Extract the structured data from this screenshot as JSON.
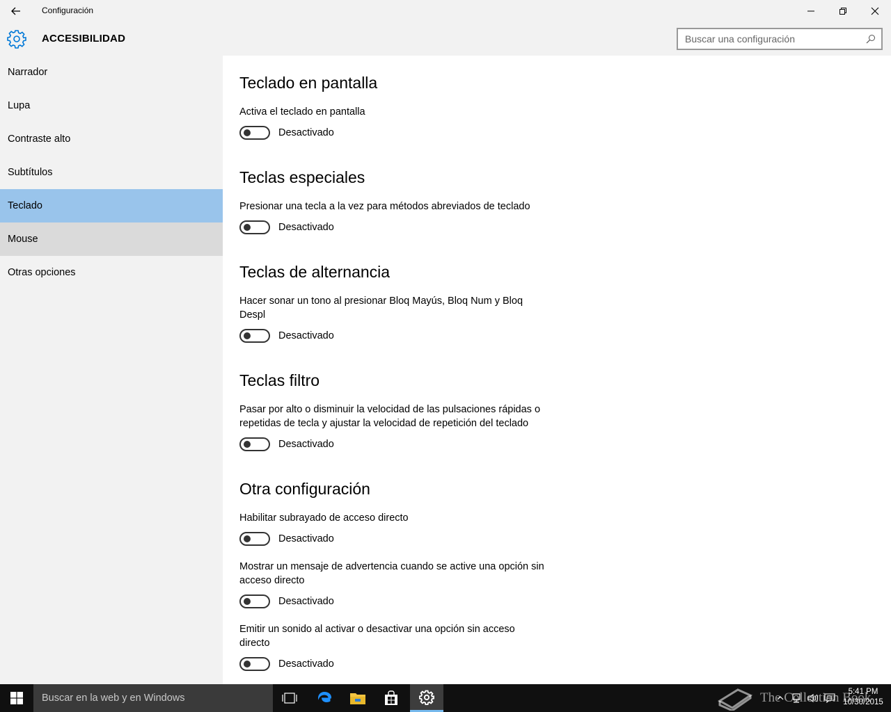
{
  "window": {
    "title": "Configuración"
  },
  "header": {
    "section_title": "ACCESIBILIDAD",
    "search_placeholder": "Buscar una configuración"
  },
  "sidebar": {
    "items": [
      {
        "label": "Narrador"
      },
      {
        "label": "Lupa"
      },
      {
        "label": "Contraste alto"
      },
      {
        "label": "Subtítulos"
      },
      {
        "label": "Teclado",
        "state": "selected"
      },
      {
        "label": "Mouse",
        "state": "hover"
      },
      {
        "label": "Otras opciones"
      }
    ]
  },
  "main": {
    "groups": [
      {
        "title": "Teclado en pantalla",
        "settings": [
          {
            "description": "Activa el teclado en pantalla",
            "toggle_state": "Desactivado"
          }
        ]
      },
      {
        "title": "Teclas especiales",
        "settings": [
          {
            "description": "Presionar una tecla a la vez para métodos abreviados de teclado",
            "toggle_state": "Desactivado"
          }
        ]
      },
      {
        "title": "Teclas de alternancia",
        "settings": [
          {
            "description": "Hacer sonar un tono al presionar Bloq Mayús, Bloq Num y Bloq Despl",
            "toggle_state": "Desactivado"
          }
        ]
      },
      {
        "title": "Teclas filtro",
        "settings": [
          {
            "description": "Pasar por alto o disminuir la velocidad de las pulsaciones rápidas o repetidas de tecla y ajustar la velocidad de repetición del teclado",
            "toggle_state": "Desactivado"
          }
        ]
      },
      {
        "title": "Otra configuración",
        "settings": [
          {
            "description": "Habilitar subrayado de acceso directo",
            "toggle_state": "Desactivado"
          },
          {
            "description": "Mostrar un mensaje de advertencia cuando se active una opción sin acceso directo",
            "toggle_state": "Desactivado"
          },
          {
            "description": "Emitir un sonido al activar o desactivar una opción sin acceso directo",
            "toggle_state": "Desactivado"
          }
        ]
      }
    ]
  },
  "taskbar": {
    "search_placeholder": "Buscar en la web y en Windows",
    "clock_time": "5:41 PM",
    "clock_date": "10/30/2015",
    "watermark_text": "The Collection Book"
  },
  "colors": {
    "accent": "#0078d7",
    "sidebar_selected": "#99c4eb",
    "sidebar_hover": "#dadada",
    "taskbar_bg": "#101010"
  }
}
